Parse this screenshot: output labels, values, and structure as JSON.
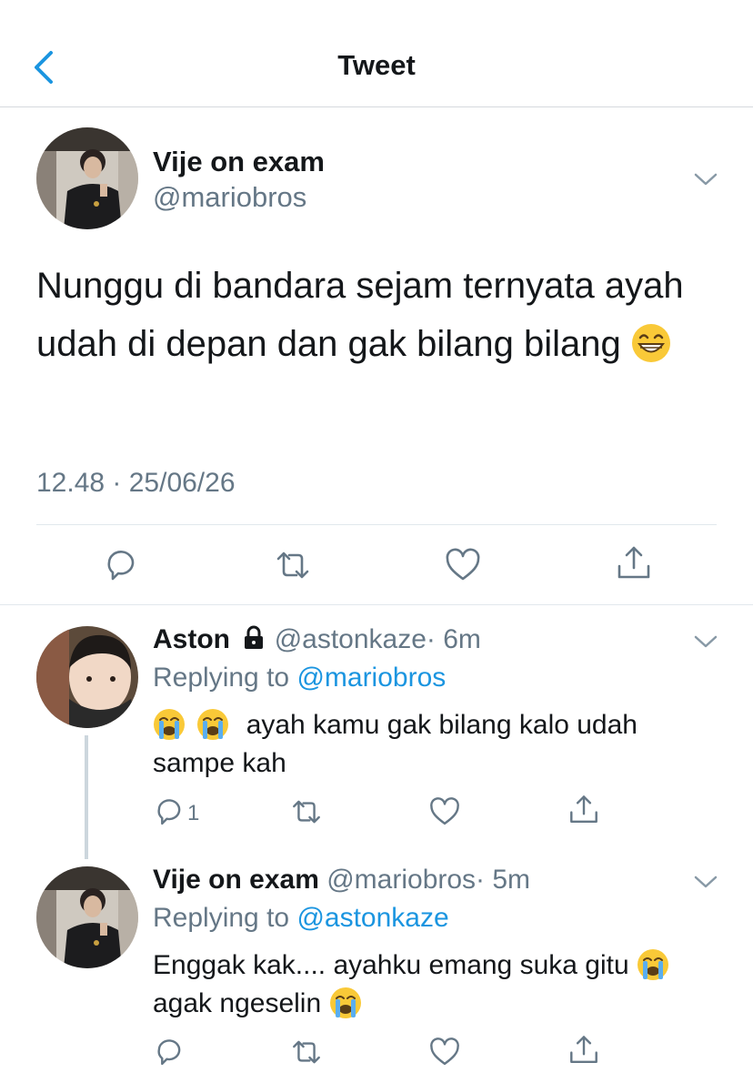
{
  "header": {
    "title": "Tweet",
    "back_icon": "chevron-left-icon"
  },
  "tweet": {
    "author_name": "Vije on exam",
    "author_handle": "@mariobros",
    "text": "Nunggu di bandara sejam ternyata ayah udah di depan dan gak bilang bilang",
    "emoji": "😁",
    "timestamp": "12.48 · 25/06/26"
  },
  "replies": [
    {
      "author_name": "Aston",
      "locked": true,
      "author_handle": "@astonkaze",
      "time": "· 6m",
      "replying_label": "Replying to",
      "replying_to": "@mariobros",
      "emoji_prefix": "😭 😭",
      "text_line1": "ayah kamu gak bilang kalo udah",
      "text_line2": "sampe kah",
      "reply_count": "1"
    },
    {
      "author_name": "Vije on exam",
      "author_handle": "@mariobros",
      "time": "· 5m",
      "replying_label": "Replying to",
      "replying_to": "@astonkaze",
      "text_line1": "Enggak kak.... ayahku emang suka gitu",
      "emoji_line1": "😭",
      "text_line2": "agak ngeselin",
      "emoji_line2": "😭"
    }
  ],
  "colors": {
    "accent": "#1b95e0",
    "secondary_text": "#657786",
    "primary_text": "#14171a",
    "divider": "#e1e8ed"
  }
}
